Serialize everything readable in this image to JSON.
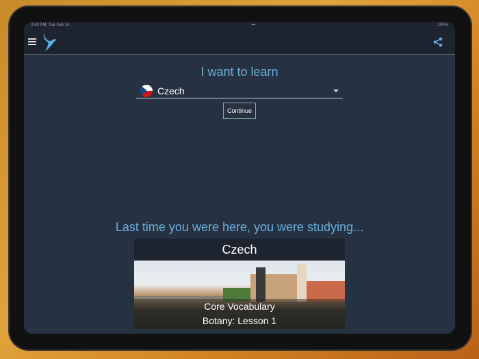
{
  "status_bar": {
    "time": "2:43 PM",
    "date": "Tue Feb 14",
    "battery": "100%"
  },
  "header": {
    "menu_icon": "hamburger-icon",
    "logo": "bird-logo",
    "share_icon": "share-icon"
  },
  "learn": {
    "title": "I want to learn",
    "selected_language": "Czech",
    "continue_label": "Continue"
  },
  "recent": {
    "heading": "Last time you were here, you were studying...",
    "card_title": "Czech",
    "course": "Core Vocabulary",
    "lesson": "Botany: Lesson 1"
  }
}
